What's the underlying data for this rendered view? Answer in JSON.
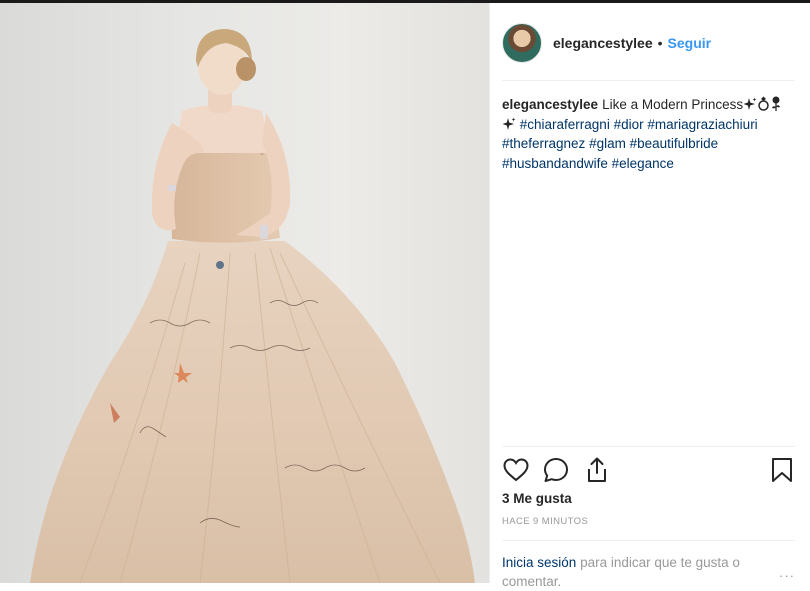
{
  "post": {
    "username": "elegancestylee",
    "separator": "•",
    "follow_label": "Seguir",
    "caption_text": "Like a Modern Princess",
    "hashtags": [
      "#chiaraferragni",
      "#dior",
      "#mariagraziachiuri",
      "#theferragnez",
      "#glam",
      "#beautifulbride",
      "#husbandandwife",
      "#elegance"
    ],
    "likes": "3 Me gusta",
    "time_ago": "HACE 9 MINUTOS",
    "login_link": "Inicia sesión",
    "login_text": "para indicar que te gusta o comentar.",
    "more": "···"
  },
  "icons": {
    "like": "heart-icon",
    "comment": "comment-icon",
    "share": "share-icon",
    "save": "bookmark-icon",
    "sparkles": "sparkles-emoji",
    "ring": "ring-emoji",
    "rose": "rose-emoji"
  },
  "colors": {
    "link_blue": "#3897f0",
    "hashtag_navy": "#003569",
    "muted_gray": "#999999"
  }
}
